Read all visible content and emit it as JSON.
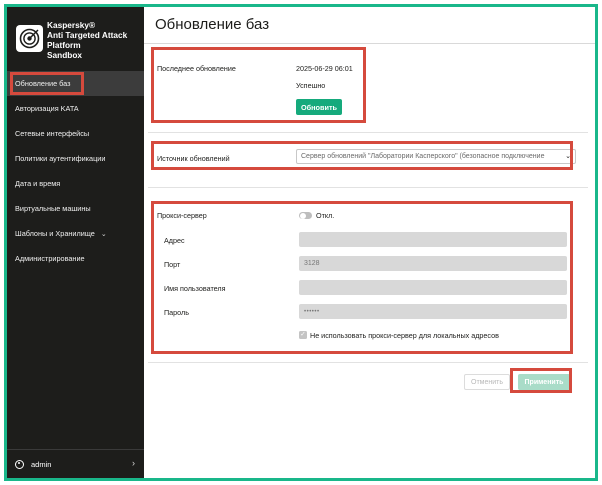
{
  "sidebar": {
    "brand": "Kaspersky®\nAnti Targeted Attack\nPlatform\nSandbox",
    "items": [
      {
        "label": "Обновление баз",
        "active": true
      },
      {
        "label": "Авторизация KATA"
      },
      {
        "label": "Сетевые интерфейсы"
      },
      {
        "label": "Политики аутентификации"
      },
      {
        "label": "Дата и время"
      },
      {
        "label": "Виртуальные машины"
      },
      {
        "label": "Шаблоны и Хранилище",
        "chevron": "⌄"
      },
      {
        "label": "Администрирование"
      }
    ],
    "footer": {
      "user": "admin",
      "chevron": "›"
    }
  },
  "main": {
    "title": "Обновление баз",
    "last_update": {
      "label": "Последнее обновление",
      "datetime": "2025-06-29 06:01",
      "status": "Успешно",
      "update_button": "Обновить"
    },
    "source": {
      "label": "Источник обновлений",
      "selected": "Сервер обновлений \"Лаборатории Касперского\" (безопасное подключение"
    },
    "proxy": {
      "label": "Прокси-сервер",
      "toggle_state": "Откл.",
      "address_label": "Адрес",
      "address_value": "",
      "port_label": "Порт",
      "port_value": "3128",
      "username_label": "Имя пользователя",
      "username_value": "",
      "password_label": "Пароль",
      "password_value": "••••••",
      "bypass_label": "Не использовать прокси-сервер для локальных адресов",
      "bypass_checked": true
    },
    "actions": {
      "cancel": "Отменить",
      "apply": "Применить"
    }
  },
  "colors": {
    "accent": "#15aa7c",
    "frame": "#19b78a",
    "annotation": "#d54a3d",
    "sidebar_bg": "#1d1d1b"
  }
}
